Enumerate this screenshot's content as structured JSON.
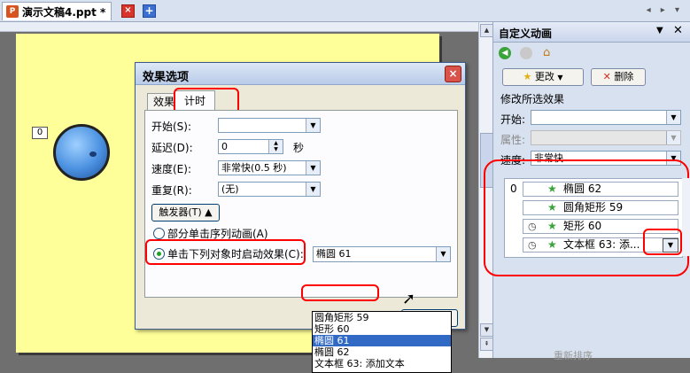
{
  "tabbar": {
    "doc_tab_label": "演示文稿4.ppt *",
    "ppt_icon": "ppt-icon",
    "close_glyph": "×",
    "new_glyph": "+",
    "nav_arrows": "◂ ▸ ▾"
  },
  "slide": {
    "animation_index": "0"
  },
  "dialog": {
    "title": "效果选项",
    "close_glyph": "×",
    "tabs": [
      {
        "label": "效果",
        "active": false
      },
      {
        "label": "计时",
        "active": true
      }
    ],
    "start_label": "开始(S):",
    "start_value": "",
    "delay_label": "延迟(D):",
    "delay_value": "0",
    "delay_unit": "秒",
    "speed_label": "速度(E):",
    "speed_value": "非常快(0.5 秒)",
    "repeat_label": "重复(R):",
    "repeat_value": "(无)",
    "trigger_button": "触发器(T) ▲",
    "radio_sequence_label": "部分单击序列动画(A)",
    "radio_trigger_label": "单击下列对象时启动效果(C):",
    "trigger_object_value": "椭圆 61",
    "object_options": [
      {
        "label": "圆角矩形 59",
        "selected": false
      },
      {
        "label": "矩形 60",
        "selected": false
      },
      {
        "label": "椭圆 61",
        "selected": true
      },
      {
        "label": "椭圆 62",
        "selected": false
      },
      {
        "label": "文本框 63: 添加文本",
        "selected": false
      }
    ]
  },
  "panel": {
    "title": "自定义动画",
    "change_button": "更改",
    "delete_button": "删除",
    "modify_label": "修改所选效果",
    "start_label": "开始:",
    "property_label": "属性:",
    "speed_label": "速度:",
    "speed_value": "非常快",
    "effects": [
      {
        "index": "0",
        "name": "椭圆 62",
        "timing": "none"
      },
      {
        "index": "",
        "name": "圆角矩形 59",
        "timing": "none"
      },
      {
        "index": "",
        "name": "矩形 60",
        "timing": "clock"
      },
      {
        "index": "",
        "name": "文本框 63: 添...",
        "timing": "clock"
      }
    ],
    "reorder_label": "重新排序"
  },
  "colors": {
    "slide_bg": "#ffff99",
    "highlight": "#ff0000",
    "selection": "#316ac5",
    "title_close": "#d9534b"
  }
}
